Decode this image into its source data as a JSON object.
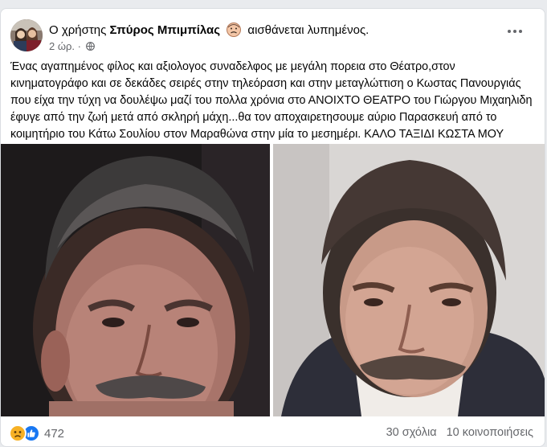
{
  "post": {
    "prefix": "Ο χρήστης",
    "author": "Σπύρος Μπιμπίλας",
    "feeling": "αισθάνεται λυπημένος.",
    "feeling_icon": "sad-face-emoji",
    "time": "2 ώρ.",
    "audience_icon": "globe-icon",
    "text_lines": [
      "Ένας αγαπημένος φίλος και αξιολογος συναδελφος   με μεγάλη πορεια στο Θέατρο,στον",
      "κινηματογράφο και σε δεκάδες σειρές στην τηλεόραση και στην μεταγλώττιση ο Κωστας Πανουργιάς",
      "που είχα την τύχη να δουλέψω μαζί του πολλα χρόνια στο ΑΝΟΙΧΤΟ ΘΕΑΤΡΟ του Γιώργου Μιχαηλιδη",
      "έφυγε από την ζωή μετά από σκληρή μάχη...θα τον αποχαιρετησουμε αύριο Παρασκευή από το",
      "κοιμητήριο του Κάτω Σουλίου στον Μαραθώνα στην μία το μεσημέρι. ΚΑΛΟ ΤΑΞΙΔΙ ΚΩΣΤΑ ΜΟΥ"
    ]
  },
  "reactions": {
    "count": "472",
    "icons": [
      "sad-reaction-icon",
      "like-reaction-icon"
    ]
  },
  "stats": {
    "comments": "30 σχόλια",
    "shares": "10 κοινοποιήσεις"
  },
  "colors": {
    "background": "#e9ebee",
    "card": "#ffffff",
    "text": "#050505",
    "secondary_text": "#65676b",
    "like_blue": "#1877f2",
    "sad_yellow": "#f7b125"
  }
}
